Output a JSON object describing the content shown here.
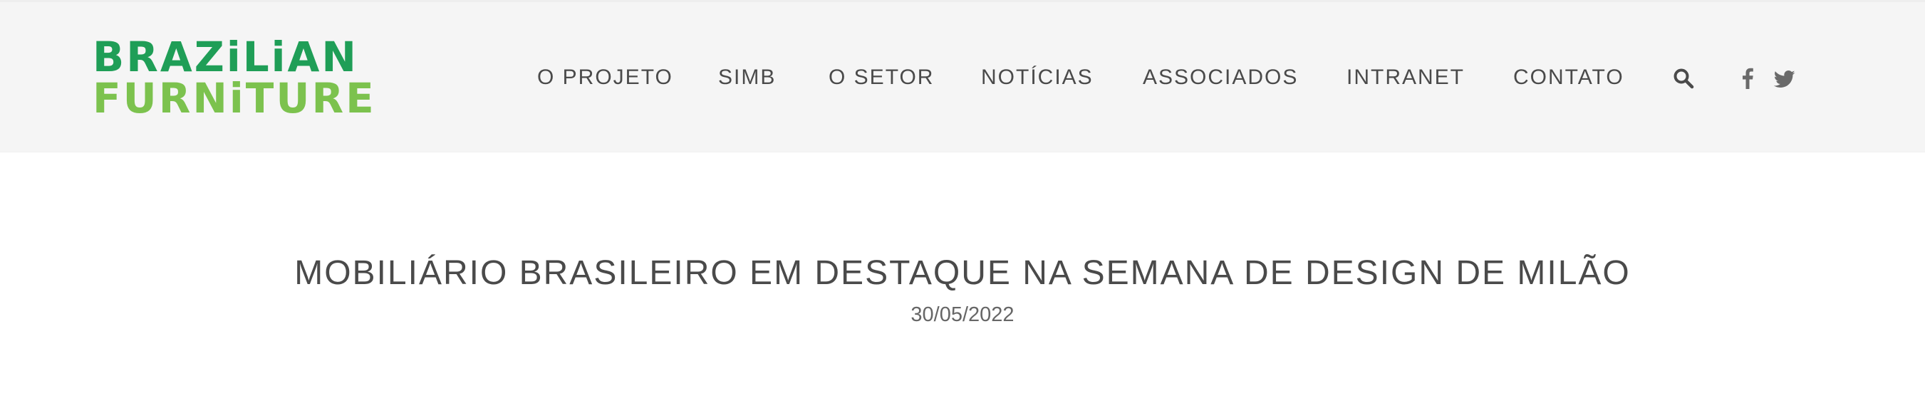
{
  "brand": {
    "line1": "BRAZiLiAN",
    "line2": "FURNiTURE",
    "colors": {
      "line1": "#1f9e57",
      "line2": "#7cc24e"
    }
  },
  "nav": {
    "items": [
      {
        "label": "O PROJETO"
      },
      {
        "label": "SIMB"
      },
      {
        "label": "O SETOR"
      },
      {
        "label": "NOTÍCIAS"
      },
      {
        "label": "ASSOCIADOS"
      },
      {
        "label": "INTRANET"
      },
      {
        "label": "CONTATO"
      }
    ],
    "icons": [
      "search-icon",
      "facebook-icon",
      "twitter-icon"
    ]
  },
  "article": {
    "title": "MOBILIÁRIO BRASILEIRO EM DESTAQUE NA SEMANA DE DESIGN DE MILÃO",
    "date": "30/05/2022"
  },
  "colors": {
    "header_bg": "#f5f5f5",
    "text": "#4a4a4a",
    "date_text": "#666666"
  }
}
